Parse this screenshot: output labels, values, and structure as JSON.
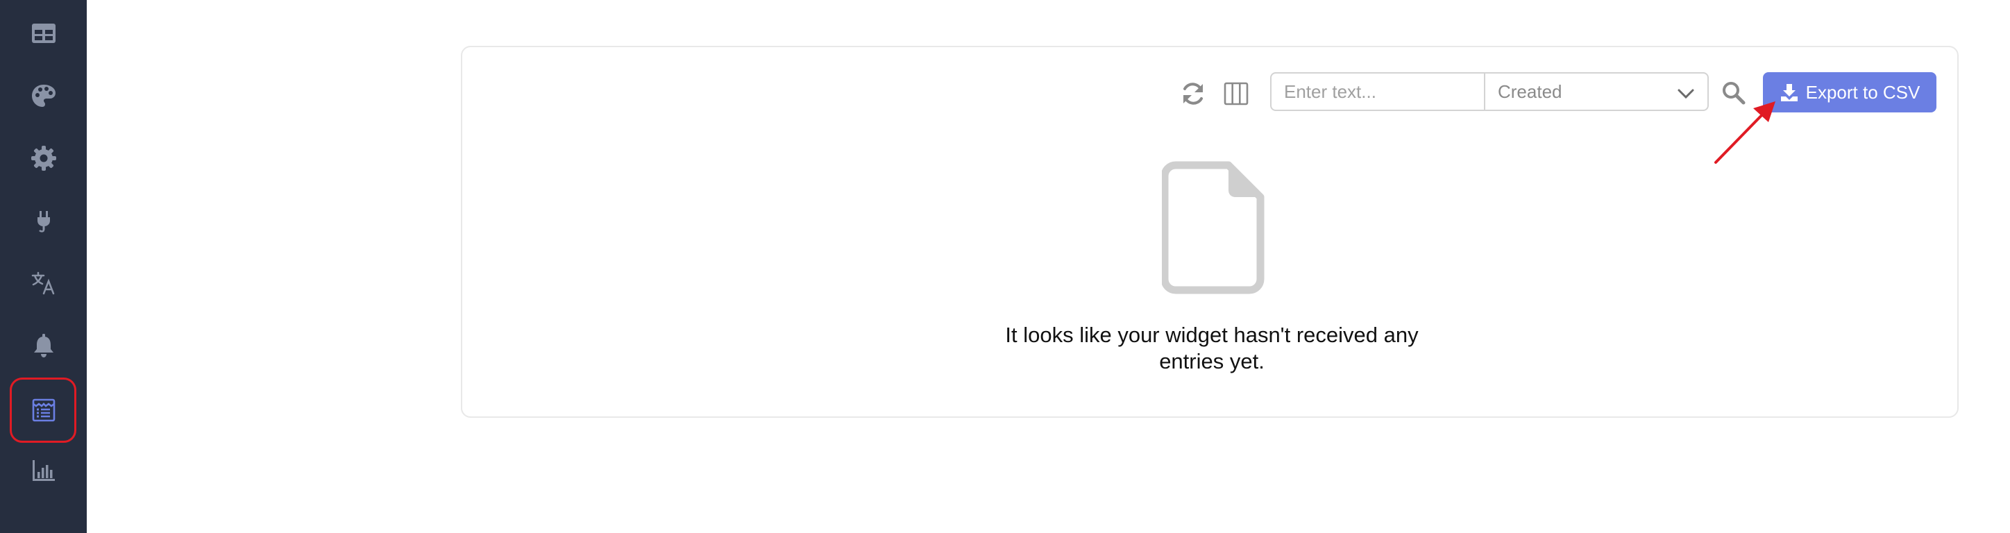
{
  "sidebar": {
    "items": [
      {
        "icon": "table-icon",
        "active": false
      },
      {
        "icon": "palette-icon",
        "active": false
      },
      {
        "icon": "gear-icon",
        "active": false
      },
      {
        "icon": "plug-icon",
        "active": false
      },
      {
        "icon": "translate-icon",
        "active": false
      },
      {
        "icon": "bell-icon",
        "active": false
      },
      {
        "icon": "entries-icon",
        "active": true
      },
      {
        "icon": "chart-icon",
        "active": false
      }
    ],
    "colors": {
      "background": "#262e3f",
      "icon": "#8a93a6",
      "active_icon": "#6b7fe3",
      "highlight": "#e01b24"
    }
  },
  "toolbar": {
    "search_placeholder": "Enter text...",
    "sort_selected": "Created",
    "export_label": "Export to CSV"
  },
  "empty_state": {
    "message": "It looks like your widget hasn't received any entries yet."
  },
  "colors": {
    "accent": "#6b7fe3",
    "annotation": "#e01b24"
  }
}
